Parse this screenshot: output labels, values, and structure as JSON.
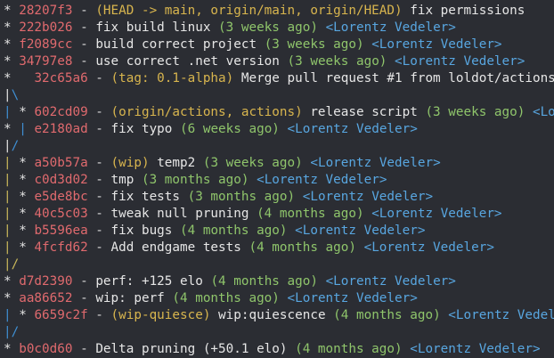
{
  "colors": {
    "background": "#2b2d33",
    "hash": "#e06a6e",
    "refs": "#d8b54e",
    "date": "#8fc56b",
    "author": "#58a6e0",
    "message": "#e6e6e6",
    "graph_white": "#e2e2e2",
    "graph_blue": "#3f8fd3",
    "graph_yellow": "#c9b75a"
  },
  "log": [
    {
      "graph": [
        [
          "* ",
          "white"
        ]
      ],
      "hash": "28207f3",
      "refs": "(HEAD -> main, origin/main, origin/HEAD)",
      "message": "fix permissions",
      "date": "",
      "author": ""
    },
    {
      "graph": [
        [
          "* ",
          "white"
        ]
      ],
      "hash": "222b026",
      "refs": "",
      "message": "fix build linux",
      "date": "(3 weeks ago)",
      "author": "<Lorentz Vedeler>"
    },
    {
      "graph": [
        [
          "* ",
          "white"
        ]
      ],
      "hash": "f2089cc",
      "refs": "",
      "message": "build correct project",
      "date": "(3 weeks ago)",
      "author": "<Lorentz Vedeler>"
    },
    {
      "graph": [
        [
          "* ",
          "white"
        ]
      ],
      "hash": "34797e8",
      "refs": "",
      "message": "use correct .net version",
      "date": "(3 weeks ago)",
      "author": "<Lorentz Vedeler>"
    },
    {
      "graph": [
        [
          "*   ",
          "white"
        ]
      ],
      "hash": "32c65a6",
      "refs": "(tag: 0.1-alpha)",
      "message": "Merge pull request #1 from loldot/actions",
      "date": "",
      "author": ""
    },
    {
      "graph": [
        [
          "|",
          "white"
        ],
        [
          "\\",
          "blue"
        ]
      ]
    },
    {
      "graph": [
        [
          "| ",
          "blue"
        ],
        [
          "* ",
          "white"
        ]
      ],
      "hash": "602cd09",
      "refs": "(origin/actions, actions)",
      "message": "release script",
      "date": "(3 weeks ago)",
      "author": "<Lorentz Vedeler>"
    },
    {
      "graph": [
        [
          "* ",
          "white"
        ],
        [
          "| ",
          "blue"
        ]
      ],
      "hash": "e2180ad",
      "refs": "",
      "message": "fix typo",
      "date": "(6 weeks ago)",
      "author": "<Lorentz Vedeler>"
    },
    {
      "graph": [
        [
          "|",
          "white"
        ],
        [
          "/",
          "blue"
        ]
      ]
    },
    {
      "graph": [
        [
          "| ",
          "yellow"
        ],
        [
          "* ",
          "white"
        ]
      ],
      "hash": "a50b57a",
      "refs": "(wip)",
      "message": "temp2",
      "date": "(3 weeks ago)",
      "author": "<Lorentz Vedeler>"
    },
    {
      "graph": [
        [
          "| ",
          "yellow"
        ],
        [
          "* ",
          "white"
        ]
      ],
      "hash": "c0d3d02",
      "refs": "",
      "message": "tmp",
      "date": "(3 months ago)",
      "author": "<Lorentz Vedeler>"
    },
    {
      "graph": [
        [
          "| ",
          "yellow"
        ],
        [
          "* ",
          "white"
        ]
      ],
      "hash": "e5de8bc",
      "refs": "",
      "message": "fix tests",
      "date": "(3 months ago)",
      "author": "<Lorentz Vedeler>"
    },
    {
      "graph": [
        [
          "| ",
          "yellow"
        ],
        [
          "* ",
          "white"
        ]
      ],
      "hash": "40c5c03",
      "refs": "",
      "message": "tweak null pruning",
      "date": "(4 months ago)",
      "author": "<Lorentz Vedeler>"
    },
    {
      "graph": [
        [
          "| ",
          "yellow"
        ],
        [
          "* ",
          "white"
        ]
      ],
      "hash": "b5596ea",
      "refs": "",
      "message": "fix bugs",
      "date": "(4 months ago)",
      "author": "<Lorentz Vedeler>"
    },
    {
      "graph": [
        [
          "| ",
          "yellow"
        ],
        [
          "* ",
          "white"
        ]
      ],
      "hash": "4fcfd62",
      "refs": "",
      "message": "Add endgame tests",
      "date": "(4 months ago)",
      "author": "<Lorentz Vedeler>"
    },
    {
      "graph": [
        [
          "|",
          "yellow"
        ],
        [
          "/",
          "yellow"
        ]
      ]
    },
    {
      "graph": [
        [
          "* ",
          "white"
        ]
      ],
      "hash": "d7d2390",
      "refs": "",
      "message": "perf: +125 elo",
      "date": "(4 months ago)",
      "author": "<Lorentz Vedeler>"
    },
    {
      "graph": [
        [
          "* ",
          "white"
        ]
      ],
      "hash": "aa86652",
      "refs": "",
      "message": "wip: perf",
      "date": "(4 months ago)",
      "author": "<Lorentz Vedeler>"
    },
    {
      "graph": [
        [
          "| ",
          "blue"
        ],
        [
          "* ",
          "white"
        ]
      ],
      "hash": "6659c2f",
      "refs": "(wip-quiesce)",
      "message": "wip:quiescence",
      "date": "(4 months ago)",
      "author": "<Lorentz Vedeler>"
    },
    {
      "graph": [
        [
          "|",
          "blue"
        ],
        [
          "/",
          "blue"
        ]
      ]
    },
    {
      "graph": [
        [
          "* ",
          "white"
        ]
      ],
      "hash": "b0c0d60",
      "refs": "",
      "message": "Delta pruning (+50.1 elo)",
      "date": "(4 months ago)",
      "author": "<Lorentz Vedeler>"
    }
  ]
}
